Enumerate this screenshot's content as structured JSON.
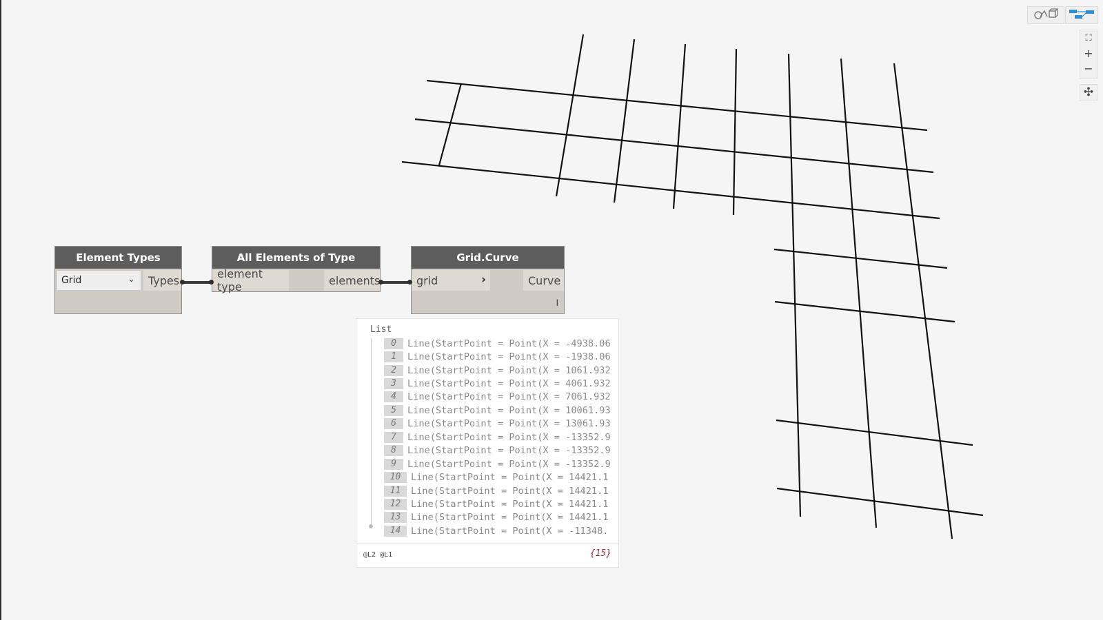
{
  "nodes": {
    "element_types": {
      "title": "Element Types",
      "selected": "Grid",
      "output": "Types"
    },
    "all_elements": {
      "title": "All Elements of Type",
      "input": "element type",
      "output": "elements"
    },
    "grid_curve": {
      "title": "Grid.Curve",
      "input": "grid",
      "output": "Curve",
      "lacing_mark": "l"
    }
  },
  "preview": {
    "header": "List",
    "items": [
      {
        "index": "0",
        "value": "Line(StartPoint = Point(X = -4938.06"
      },
      {
        "index": "1",
        "value": "Line(StartPoint = Point(X = -1938.06"
      },
      {
        "index": "2",
        "value": "Line(StartPoint = Point(X = 1061.932"
      },
      {
        "index": "3",
        "value": "Line(StartPoint = Point(X = 4061.932"
      },
      {
        "index": "4",
        "value": "Line(StartPoint = Point(X = 7061.932"
      },
      {
        "index": "5",
        "value": "Line(StartPoint = Point(X = 10061.93"
      },
      {
        "index": "6",
        "value": "Line(StartPoint = Point(X = 13061.93"
      },
      {
        "index": "7",
        "value": "Line(StartPoint = Point(X = -13352.9"
      },
      {
        "index": "8",
        "value": "Line(StartPoint = Point(X = -13352.9"
      },
      {
        "index": "9",
        "value": "Line(StartPoint = Point(X = -13352.9"
      },
      {
        "index": "10",
        "value": "Line(StartPoint = Point(X = 14421.1"
      },
      {
        "index": "11",
        "value": "Line(StartPoint = Point(X = 14421.1"
      },
      {
        "index": "12",
        "value": "Line(StartPoint = Point(X = 14421.1"
      },
      {
        "index": "13",
        "value": "Line(StartPoint = Point(X = 14421.1"
      },
      {
        "index": "14",
        "value": "Line(StartPoint = Point(X = -11348."
      }
    ],
    "levels": "@L2 @L1",
    "count": "{15}"
  },
  "icons": {
    "view_toggle": "geometry-view-icon",
    "graph_toggle": "graph-view-icon",
    "zoom_fit": "zoom-extents-icon",
    "zoom_in": "plus-icon",
    "zoom_out": "minus-icon",
    "pan": "pan-move-icon"
  },
  "colors": {
    "node_header": "#5d5d5d",
    "node_body": "#cfcac3",
    "count_text": "#a0313a",
    "graph_icon": "#2b8fd6"
  }
}
